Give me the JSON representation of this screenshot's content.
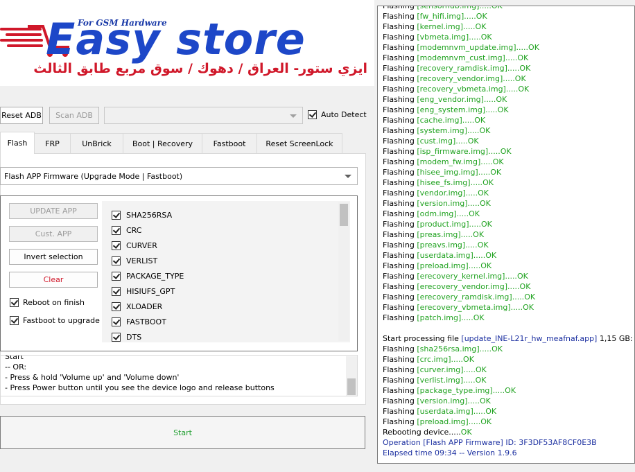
{
  "logo": {
    "tagline": "For GSM Hardware",
    "brand": "Easy store",
    "arabic_line": "ايزي ستور- العراق / دهوك / سوق مربع طابق الثالث"
  },
  "toolbar": {
    "reset_adb": "Reset ADB",
    "scan_adb": "Scan ADB",
    "device_combo_value": "",
    "auto_detect": "Auto Detect"
  },
  "tabs": [
    "Flash",
    "FRP",
    "UnBrick",
    "Boot | Recovery",
    "Fastboot",
    "Reset ScreenLock"
  ],
  "mode_select": "Flash APP Firmware (Upgrade Mode | Fastboot)",
  "actions": {
    "update_app": "UPDATE APP",
    "cust_app": "Cust. APP",
    "invert_selection": "Invert selection",
    "clear": "Clear",
    "reboot_on_finish": "Reboot on finish",
    "fastboot_to_upgrade": "Fastboot to upgrade"
  },
  "partitions": [
    "SHA256RSA",
    "CRC",
    "CURVER",
    "VERLIST",
    "PACKAGE_TYPE",
    "HISIUFS_GPT",
    "XLOADER",
    "FASTBOOT",
    "DTS"
  ],
  "instructions": [
    "Start",
    "-- OR:",
    "- Press & hold 'Volume up' and 'Volume down'",
    "- Press Power button until you see the device logo and release buttons"
  ],
  "start_button": "Start",
  "log": {
    "flash_prefix": "Flashing ",
    "ok": "OK",
    "first_block": [
      "[sensorhub.img].....",
      "[fw_hifi.img].....",
      "[kernel.img].....",
      "[vbmeta.img].....",
      "[modemnvm_update.img].....",
      "[modemnvm_cust.img].....",
      "[recovery_ramdisk.img].....",
      "[recovery_vendor.img].....",
      "[recovery_vbmeta.img].....",
      "[eng_vendor.img].....",
      "[eng_system.img].....",
      "[cache.img].....",
      "[system.img].....",
      "[cust.img].....",
      "[isp_firmware.img].....",
      "[modem_fw.img].....",
      "[hisee_img.img].....",
      "[hisee_fs.img].....",
      "[vendor.img].....",
      "[version.img].....",
      "[odm.img].....",
      "[product.img].....",
      "[preas.img].....",
      "[preavs.img].....",
      "[userdata.img].....",
      "[preload.img].....",
      "[erecovery_kernel.img].....",
      "[erecovery_vendor.img].....",
      "[erecovery_ramdisk.img].....",
      "[erecovery_vbmeta.img].....",
      "[patch.img]....."
    ],
    "processing_prefix": "Start processing file ",
    "processing_file": "[update_INE-L21r_hw_meafnaf.app]",
    "processing_size": " 1,15 GB:",
    "second_block": [
      "[sha256rsa.img].....",
      "[crc.img].....",
      "[curver.img].....",
      "[verlist.img].....",
      "[package_type.img].....",
      "[version.img].....",
      "[userdata.img].....",
      "[preload.img]....."
    ],
    "rebooting_label": "Rebooting device.....",
    "operation": "Operation [Flash APP Firmware] ID: 3F3DF53AF8CF0E3B",
    "elapsed": "Elapsed time 09:34 -- Version 1.9.6"
  },
  "colors": {
    "ok_green": "#1fa21f",
    "info_blue": "#1b2fa0",
    "clear_red": "#d0182a",
    "start_green": "#1e9e2e",
    "logo_blue": "#1d47c8",
    "logo_red": "#d0182a"
  }
}
